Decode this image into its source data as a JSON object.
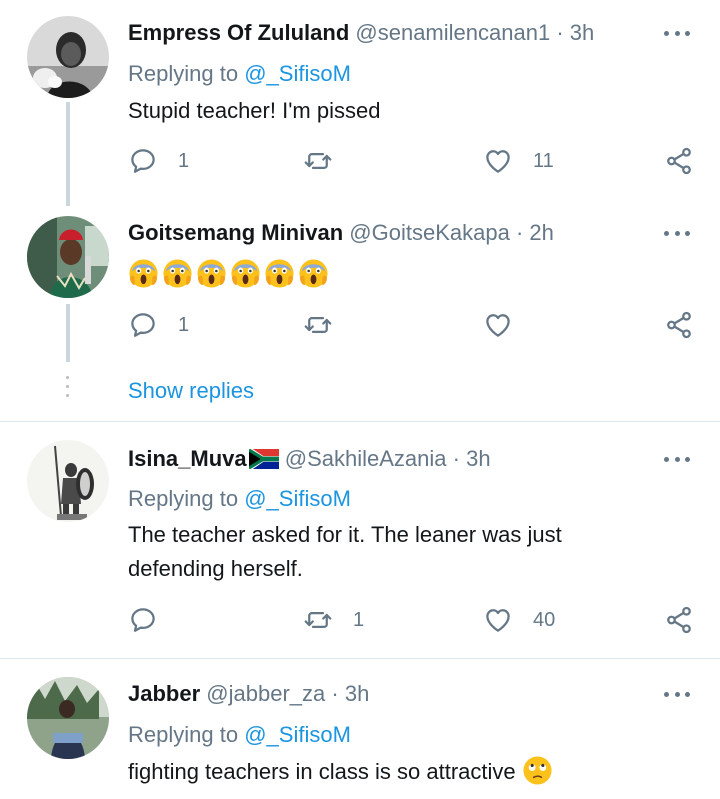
{
  "tweets": [
    {
      "name": "Empress Of Zululand",
      "handle": "@senamilencanan1",
      "separator": "·",
      "time": "3h",
      "replying_prefix": "Replying to",
      "replying_to": "@_SifisoM",
      "text": "Stupid teacher! I'm pissed",
      "replies": "1",
      "retweets": "",
      "likes": "11"
    },
    {
      "name": "Goitsemang Minivan",
      "handle": "@GoitseKakapa",
      "separator": "·",
      "time": "2h",
      "emoji": "😱😱😱😱😱😱",
      "replies": "1",
      "retweets": "",
      "likes": ""
    },
    {
      "name": "Isina_Muva",
      "handle": "@SakhileAzania",
      "separator": "·",
      "time": "3h",
      "replying_prefix": "Replying to",
      "replying_to": "@_SifisoM",
      "text": "The teacher asked for it. The leaner was just defending herself.",
      "replies": "",
      "retweets": "1",
      "likes": "40"
    },
    {
      "name": "Jabber",
      "handle": "@jabber_za",
      "separator": "·",
      "time": "3h",
      "replying_prefix": "Replying to",
      "replying_to": "@_SifisoM",
      "text": "fighting teachers in class is so attractive"
    }
  ],
  "show_replies": "Show replies",
  "icons": {
    "more": "more-icon",
    "reply": "reply-icon",
    "retweet": "retweet-icon",
    "like": "heart-icon",
    "share": "share-icon",
    "flag": "south-africa-flag-icon",
    "scream_emoji": "face-screaming-emoji",
    "eye_roll_emoji": "face-rolling-eyes-emoji"
  },
  "colors": {
    "link": "#1b95e0",
    "secondary_text": "#657786",
    "thread_line": "#ccd6dd",
    "divider": "#e1e8ed"
  }
}
